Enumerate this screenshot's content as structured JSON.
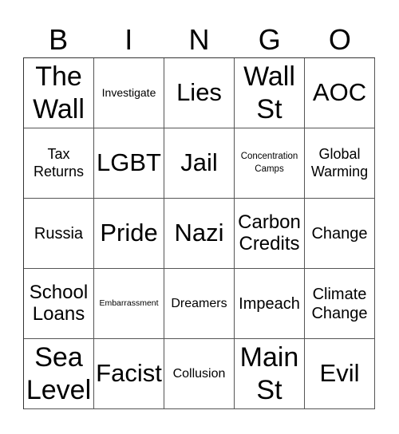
{
  "header": {
    "letters": [
      "B",
      "I",
      "N",
      "G",
      "O"
    ]
  },
  "cells": [
    [
      "The\nWall",
      "Investigate",
      "Lies",
      "Wall\nSt",
      "AOC"
    ],
    [
      "Tax\nReturns",
      "LGBT",
      "Jail",
      "Concentration\nCamps",
      "Global\nWarming"
    ],
    [
      "Russia",
      "Pride",
      "Nazi",
      "Carbon\nCredits",
      "Change"
    ],
    [
      "School\nLoans",
      "Embarrassment",
      "Dreamers",
      "Impeach",
      "Climate\nChange"
    ],
    [
      "Sea\nLevel",
      "Facist",
      "Collusion",
      "Main\nSt",
      "Evil"
    ]
  ]
}
